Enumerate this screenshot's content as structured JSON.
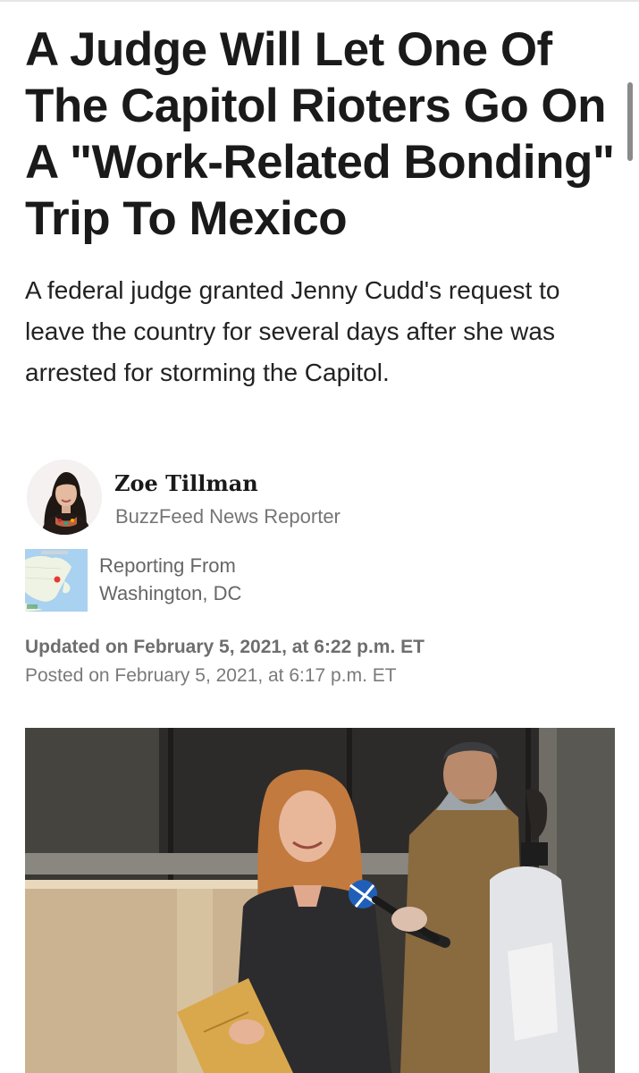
{
  "article": {
    "headline": "A Judge Will Let One Of The Capitol Rioters Go On A \"Work-Related Bonding\" Trip To Mexico",
    "dek": "A federal judge granted Jenny Cudd's request to leave the country for several days after she was arrested for storming the Capitol."
  },
  "byline": {
    "name": "Zoe Tillman",
    "title": "BuzzFeed News Reporter",
    "reporting_label": "Reporting From",
    "reporting_place": "Washington, DC"
  },
  "timestamps": {
    "updated": "Updated on February 5, 2021, at 6:22 p.m. ET",
    "posted": "Posted on February 5, 2021, at 6:17 p.m. ET"
  },
  "colors": {
    "headline": "#1a1a1a",
    "meta_gray": "#757575",
    "map_pin": "#e53935"
  },
  "icons": [
    "author-avatar",
    "map-pin-icon",
    "news-microphone-icon"
  ]
}
